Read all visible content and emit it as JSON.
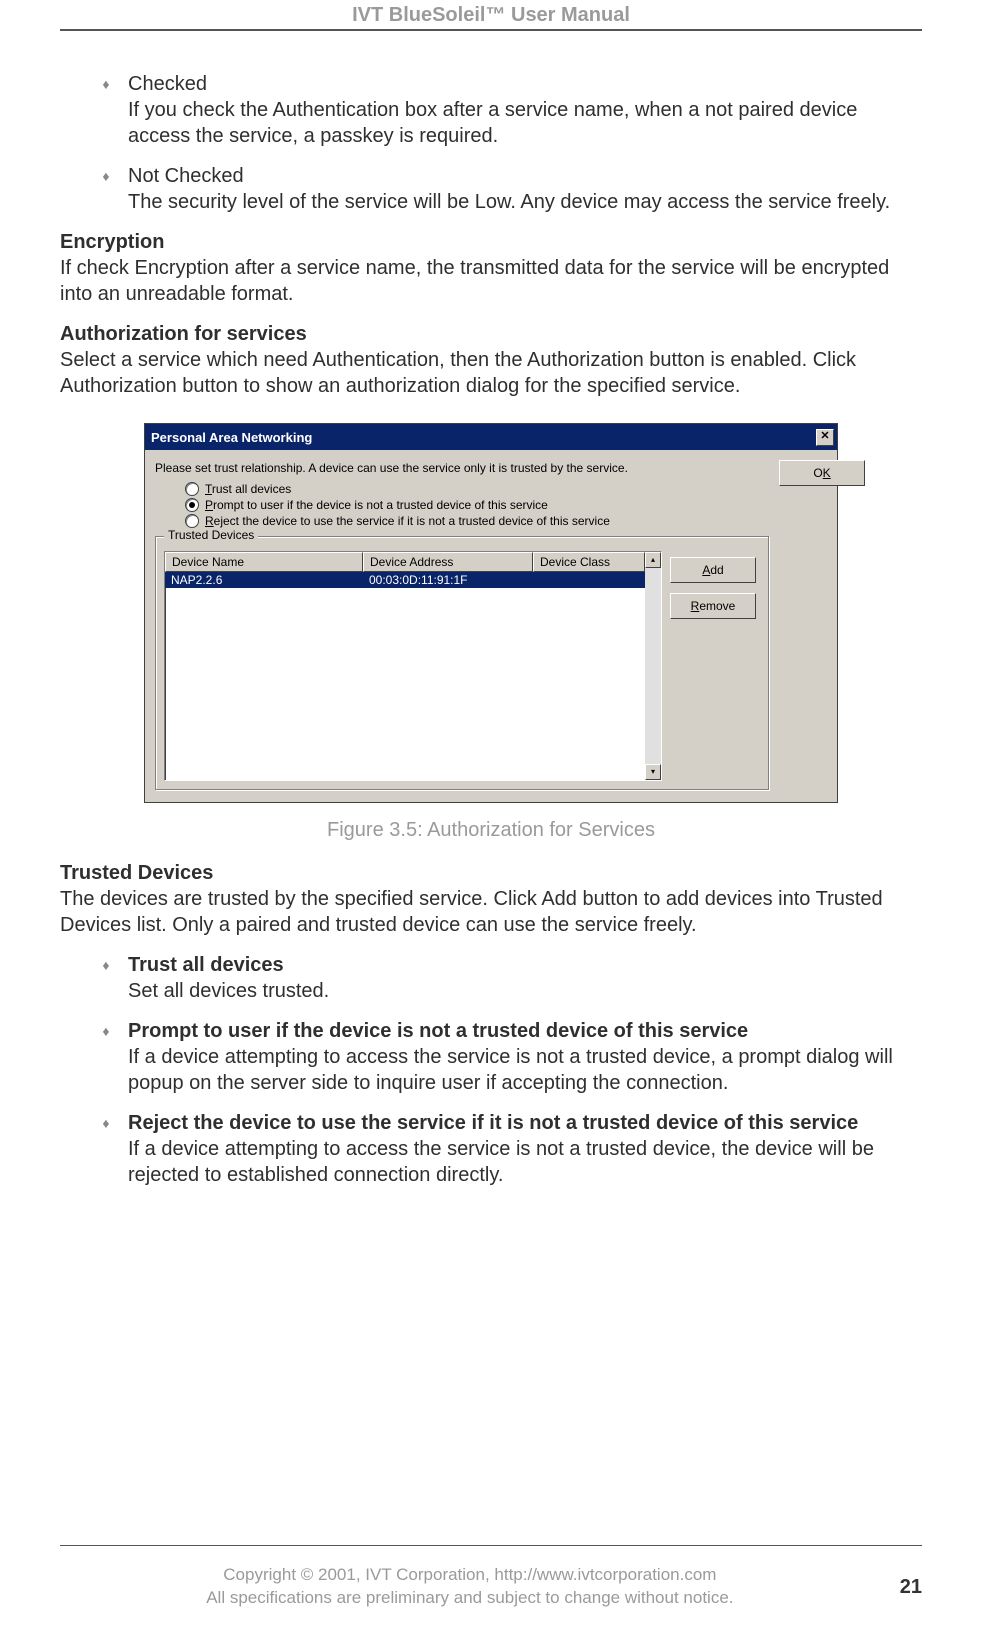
{
  "doc": {
    "title": "IVT BlueSoleil™ User Manual",
    "page_number": "21",
    "footer_line1": "Copyright © 2001, IVT Corporation, http://www.ivtcorporation.com",
    "footer_line2": "All specifications are preliminary and subject to change without notice."
  },
  "content": {
    "bullets_top": [
      {
        "term": "Checked",
        "desc": "If you check the Authentication box after a service name, when a not paired device access the service, a passkey is required."
      },
      {
        "term": "Not Checked",
        "desc": "The security level of the service will be Low. Any device may access the service freely."
      }
    ],
    "encryption": {
      "heading": "Encryption",
      "text": "If check Encryption after a service name, the transmitted data for the service will be encrypted into an unreadable format."
    },
    "auth_services": {
      "heading": "Authorization for services",
      "text": "Select a service which need Authentication, then the Authorization button is enabled. Click Authorization button to show an authorization dialog for the specified service."
    },
    "figure_caption": "Figure 3.5: Authorization for Services",
    "trusted_devices": {
      "heading": "Trusted Devices",
      "text": "The devices are trusted by the specified service. Click Add button to add devices into Trusted Devices list. Only a paired and trusted device can use the service freely."
    },
    "bullets_bottom": [
      {
        "term": "Trust all devices",
        "desc": "Set all devices trusted."
      },
      {
        "term": "Prompt to user if the device is not a trusted device of this service",
        "desc": "If a device attempting to access the service is not a trusted device, a prompt dialog will popup on the server side to inquire user if accepting the connection."
      },
      {
        "term": "Reject the device to use the service if it is not a trusted device of this service",
        "desc": "If a device attempting to access the service is not a trusted device, the device will be rejected to established connection directly."
      }
    ]
  },
  "dialog": {
    "title": "Personal Area Networking",
    "instruction": "Please set trust relationship. A device can use the service only  it is trusted by the service.",
    "buttons": {
      "ok_pre": "O",
      "ok_u": "K",
      "add_u": "A",
      "add_post": "dd",
      "remove_u": "R",
      "remove_post": "emove"
    },
    "radios": [
      {
        "u": "T",
        "post": "rust all devices",
        "selected": false
      },
      {
        "u": "P",
        "post": "rompt to user if the device is not a trusted device of this service",
        "selected": true
      },
      {
        "u": "R",
        "post": "eject the device to use the service if it is not a trusted device of this service",
        "selected": false
      }
    ],
    "group_legend": "Trusted Devices",
    "columns": {
      "name": "Device Name",
      "addr": "Device Address",
      "class": "Device Class"
    },
    "rows": [
      {
        "name": "NAP2.2.6",
        "addr": "00:03:0D:11:91:1F",
        "class": "",
        "selected": true
      }
    ]
  }
}
